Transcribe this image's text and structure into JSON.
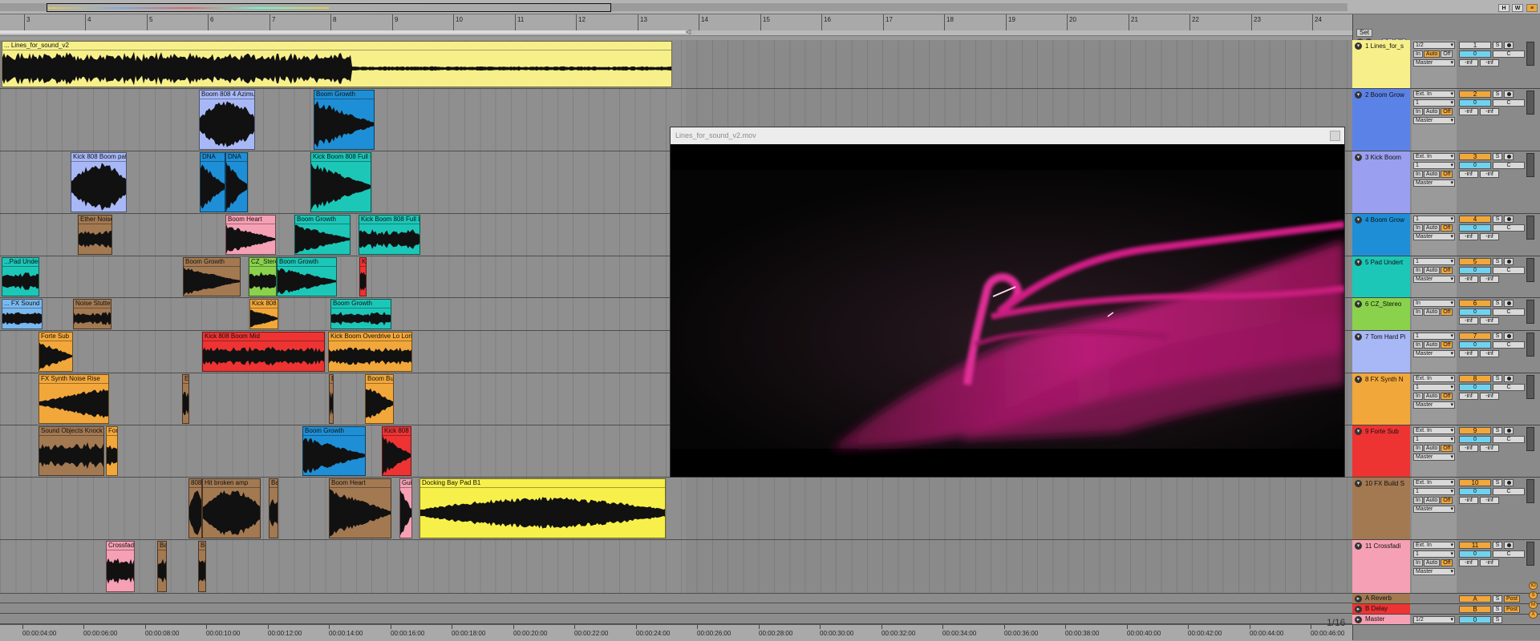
{
  "overview": {
    "buttons": [
      "H",
      "W"
    ]
  },
  "ruler": {
    "bars": [
      "3",
      "4",
      "5",
      "6",
      "7",
      "8",
      "9",
      "10",
      "11",
      "12",
      "13",
      "14",
      "15",
      "16",
      "17",
      "18",
      "19",
      "20",
      "21",
      "22",
      "23",
      "24"
    ]
  },
  "set_button": "Set",
  "time_ruler": {
    "labels": [
      "00:00:04:00",
      "00:00:06:00",
      "00:00:08:00",
      "00:00:10:00",
      "00:00:12:00",
      "00:00:14:00",
      "00:00:16:00",
      "00:00:18:00",
      "00:00:20:00",
      "00:00:22:00",
      "00:00:24:00",
      "00:00:26:00",
      "00:00:28:00",
      "00:00:30:00",
      "00:00:32:00",
      "00:00:34:00",
      "00:00:36:00",
      "00:00:38:00",
      "00:00:40:00",
      "00:00:42:00",
      "00:00:44:00",
      "00:00:46:00"
    ]
  },
  "grid_label": "1/16",
  "video": {
    "title": "Lines_for_sound_v2.mov"
  },
  "tracks": [
    {
      "name": "1 Lines_for_s",
      "color": "#f7f08a",
      "io": "1/2",
      "io2": "",
      "num": "1",
      "num_color": "#d9d9d9",
      "vol": "0",
      "pan": "C",
      "send_a": "-inf",
      "send_b": "-inf",
      "out": "Master",
      "mon_off": false,
      "clips": [
        {
          "title": "... Lines_for_sound_v2",
          "color": "#f7f08a"
        }
      ]
    },
    {
      "name": "2 Boom Grow",
      "color": "#5b82e6",
      "io": "Ext. In",
      "io2": "1",
      "num": "2",
      "num_color": "#f2a73a",
      "vol": "0",
      "pan": "C",
      "send_a": "-inf",
      "send_b": "-inf",
      "out": "Master",
      "mon_off": true,
      "clips": [
        {
          "title": "Boom 808 4 Azimut",
          "color": "#a8b8f7"
        },
        {
          "title": "Boom Growth",
          "color": "#1e8fd6"
        }
      ]
    },
    {
      "name": "3 Kick Boom",
      "color": "#9a9ff0",
      "io": "Ext. In",
      "io2": "1",
      "num": "3",
      "num_color": "#f2a73a",
      "vol": "0",
      "pan": "C",
      "send_a": "-inf",
      "send_b": "-inf",
      "out": "Master",
      "mon_off": true,
      "clips": [
        {
          "title": "Kick 808 Boom patt",
          "color": "#a8b8f7"
        },
        {
          "title": "DNA",
          "color": "#1e8fd6"
        },
        {
          "title": "DNA",
          "color": "#1e8fd6"
        },
        {
          "title": "Kick Boom 808 Full Lo",
          "color": "#1cc7b8"
        }
      ]
    },
    {
      "name": "4 Boom Grow",
      "color": "#1e8fd6",
      "io": "1",
      "io2": "",
      "num": "4",
      "num_color": "#f2a73a",
      "vol": "0",
      "pan": "C",
      "send_a": "-inf",
      "send_b": "-inf",
      "out": "Master",
      "mon_off": true,
      "clips": [
        {
          "title": "Ether Noise",
          "color": "#a37952"
        },
        {
          "title": "Boom Heart",
          "color": "#f5a0b4"
        },
        {
          "title": "Boom Growth",
          "color": "#1cc7b8"
        },
        {
          "title": "Kick Boom 808 Full Lo",
          "color": "#1cc7b8"
        }
      ]
    },
    {
      "name": "5 Pad Undert",
      "color": "#1cc7b8",
      "io": "1",
      "io2": "",
      "num": "5",
      "num_color": "#f2a73a",
      "vol": "0",
      "pan": "C",
      "send_a": "-inf",
      "send_b": "-inf",
      "out": "Master",
      "mon_off": true,
      "clips": [
        {
          "title": "...Pad Under",
          "color": "#1cc7b8"
        },
        {
          "title": "Boom Growth",
          "color": "#a37952"
        },
        {
          "title": "CZ_Stere",
          "color": "#8ad24c"
        },
        {
          "title": "Boom Growth",
          "color": "#1cc7b8"
        },
        {
          "title": "Ki",
          "color": "#ee3333"
        }
      ]
    },
    {
      "name": "6 CZ_Stereo",
      "color": "#8ad24c",
      "io": "In",
      "io2": "",
      "num": "6",
      "num_color": "#f2a73a",
      "vol": "0",
      "pan": "C",
      "send_a": "-inf",
      "send_b": "-inf",
      "out": "",
      "mon_off": true,
      "clips": [
        {
          "title": "... FX Sound -",
          "color": "#7ab8f0"
        },
        {
          "title": "Noise Stutte",
          "color": "#a37952"
        },
        {
          "title": "Kick 808 B",
          "color": "#f2a73a"
        },
        {
          "title": "Boom Growth",
          "color": "#1cc7b8"
        }
      ]
    },
    {
      "name": "7 Tom Hard Pi",
      "color": "#a8b8f7",
      "io": "1",
      "io2": "",
      "num": "7",
      "num_color": "#f2a73a",
      "vol": "0",
      "pan": "C",
      "send_a": "-inf",
      "send_b": "-inf",
      "out": "Master",
      "mon_off": true,
      "clips": [
        {
          "title": "Forte Sub",
          "color": "#f2a73a"
        },
        {
          "title": "Kick 808 Boom Mid",
          "color": "#ee3333"
        },
        {
          "title": "Kick Boom Overdrive Lo Long",
          "color": "#f2a73a"
        }
      ]
    },
    {
      "name": "8 FX Synth N",
      "color": "#f2a73a",
      "io": "Ext. In",
      "io2": "1",
      "num": "8",
      "num_color": "#f2a73a",
      "vol": "0",
      "pan": "C",
      "send_a": "-inf",
      "send_b": "-inf",
      "out": "Master",
      "mon_off": true,
      "clips": [
        {
          "title": "FX Synth Noise Rise",
          "color": "#f2a73a"
        },
        {
          "title": "E",
          "color": "#a37952"
        },
        {
          "title": "E",
          "color": "#a37952"
        },
        {
          "title": "Boom But",
          "color": "#f2a73a"
        }
      ]
    },
    {
      "name": "9 Forte Sub",
      "color": "#ee3333",
      "io": "Ext. In",
      "io2": "1",
      "num": "9",
      "num_color": "#f2a73a",
      "vol": "0",
      "pan": "C",
      "send_a": "-inf",
      "send_b": "-inf",
      "out": "Master",
      "mon_off": true,
      "clips": [
        {
          "title": "Sound Objects Knock",
          "color": "#a37952"
        },
        {
          "title": "For",
          "color": "#f2a73a"
        },
        {
          "title": "Boom Growth",
          "color": "#1e8fd6"
        },
        {
          "title": "Kick 808 E",
          "color": "#ee3333"
        }
      ]
    },
    {
      "name": "10 FX Build S",
      "color": "#a37952",
      "io": "Ext. In",
      "io2": "1",
      "num": "10",
      "num_color": "#f2a73a",
      "vol": "0",
      "pan": "C",
      "send_a": "-inf",
      "send_b": "-inf",
      "out": "Master",
      "mon_off": true,
      "clips": [
        {
          "title": "808",
          "color": "#a37952"
        },
        {
          "title": "Hit broken amp",
          "color": "#a37952"
        },
        {
          "title": "Ba",
          "color": "#a37952"
        },
        {
          "title": "Boom Heart",
          "color": "#a37952"
        },
        {
          "title": "Gui",
          "color": "#f5a0b4"
        },
        {
          "title": "Docking Bay Pad B1",
          "color": "#f7f04a"
        }
      ]
    },
    {
      "name": "11 Crossfadi",
      "color": "#f5a0b4",
      "io": "Ext. In",
      "io2": "1",
      "num": "11",
      "num_color": "#f2a73a",
      "vol": "0",
      "pan": "C",
      "send_a": "-inf",
      "send_b": "-inf",
      "out": "Master",
      "mon_off": true,
      "clips": [
        {
          "title": "Crossfad",
          "color": "#f5a0b4"
        },
        {
          "title": "Ba",
          "color": "#a37952"
        },
        {
          "title": "Bo",
          "color": "#a37952"
        }
      ]
    }
  ],
  "returns": [
    {
      "name": "A Reverb",
      "color": "#a37952",
      "letter": "A",
      "post": "Post"
    },
    {
      "name": "B Delay",
      "color": "#ee3333",
      "letter": "B",
      "post": "Post"
    },
    {
      "name": "Master",
      "color": "#f5a0b4",
      "letter": "0",
      "post": "",
      "io": "1/2"
    }
  ],
  "labels": {
    "in": "In",
    "auto": "Auto",
    "off": "Off",
    "solo": "S",
    "pan_c": "C"
  }
}
